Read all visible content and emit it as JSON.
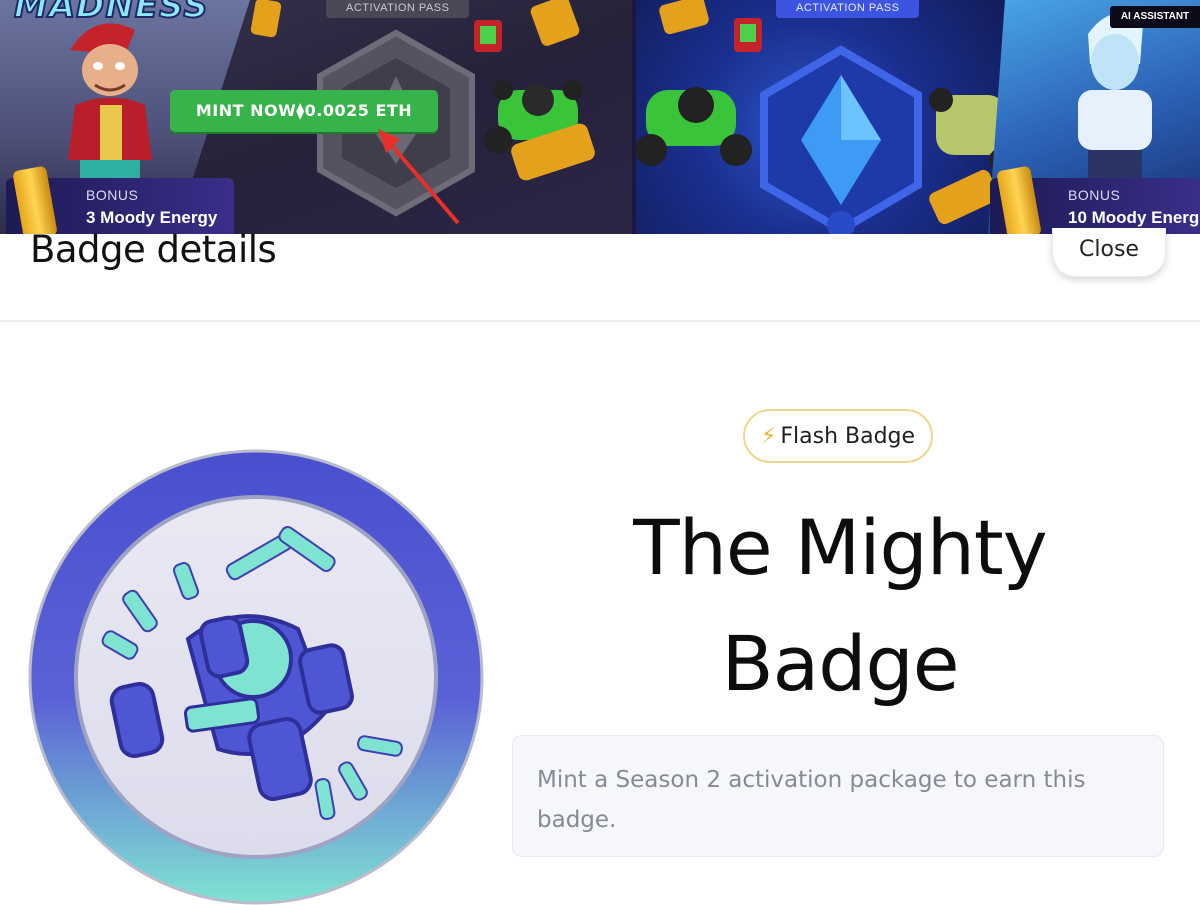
{
  "banner": {
    "logo_text": "MADNESS",
    "activation_pass_left": "ACTIVATION PASS",
    "activation_pass_right": "ACTIVATION PASS",
    "mint_button": "MINT NOW⧫0.0025 ETH",
    "bonus_left": {
      "label": "BONUS",
      "value": "3 Moody Energy"
    },
    "bonus_right": {
      "label": "BONUS",
      "value": "10 Moody Energ"
    },
    "ai_tag": "AI ASSISTANT",
    "colors": {
      "mint_green": "#36b34a",
      "arrow_red": "#e8302a",
      "pass_blue": "#3c54e0"
    }
  },
  "header": {
    "title": "Badge details",
    "close_label": "Close"
  },
  "badge": {
    "type_label": "Flash Badge",
    "type_icon": "lightning-bolt-icon",
    "name": "The Mighty Badge",
    "description": "Mint a Season 2 activation package to earn this badge.",
    "image_icon": "kart-badge-icon",
    "colors": {
      "ring_top": "#4a4fcf",
      "ring_bottom": "#7fe3d2",
      "pill_border": "#f1d58e"
    }
  }
}
